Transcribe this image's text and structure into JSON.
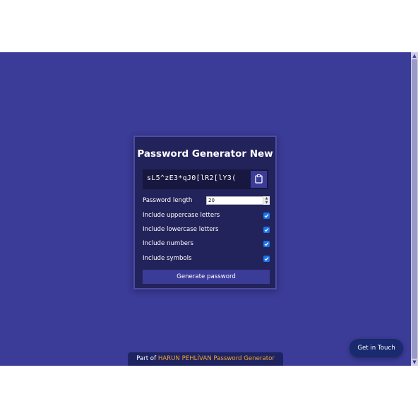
{
  "card": {
    "title": "Password Generator New",
    "password": "sL5^zE3*qJ0[lR2[lY3(",
    "copy_icon": "clipboard-icon",
    "length_label": "Password length",
    "length_value": "20",
    "options": [
      {
        "label": "Include uppercase letters",
        "checked": true
      },
      {
        "label": "Include lowercase letters",
        "checked": true
      },
      {
        "label": "Include numbers",
        "checked": true
      },
      {
        "label": "Include symbols",
        "checked": true
      }
    ],
    "generate_label": "Generate password"
  },
  "footer": {
    "prefix": "Part of",
    "link_text": "HARUN PEHLİVAN Password Generator"
  },
  "contact": {
    "label": "Get in Touch"
  },
  "colors": {
    "background": "#3b3b98",
    "card": "#23235b",
    "accent": "#3b3b98",
    "checkbox": "#1a73e8",
    "link": "#f0a030"
  }
}
